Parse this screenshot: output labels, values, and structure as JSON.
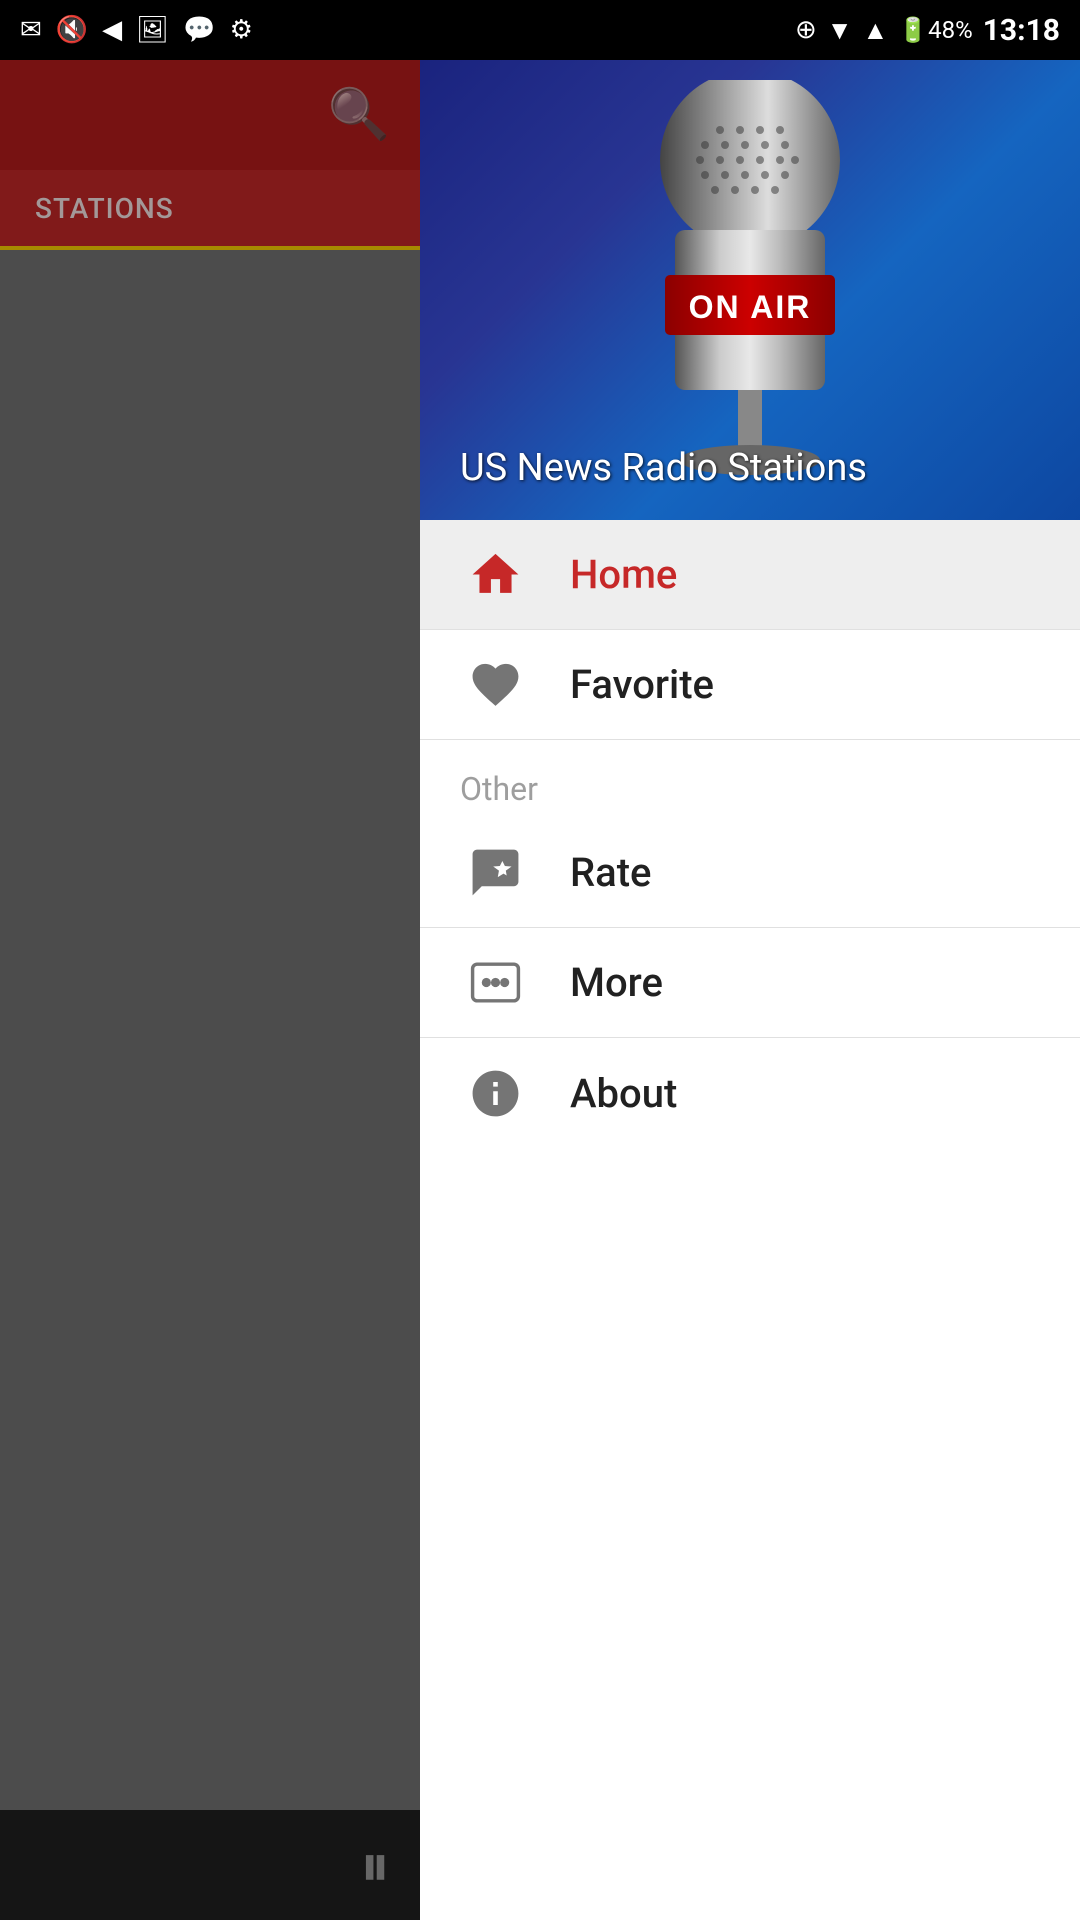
{
  "statusBar": {
    "time": "13:18",
    "battery": "48%"
  },
  "hero": {
    "title": "US News Radio Stations",
    "micLabel": "ON AIR"
  },
  "nav": {
    "homeLabel": "Home",
    "favoriteLabel": "Favorite",
    "otherSectionLabel": "Other",
    "rateLabel": "Rate",
    "moreLabel": "More",
    "aboutLabel": "About"
  },
  "appBar": {
    "tabLabel": "STATIONS"
  },
  "colors": {
    "activeRed": "#c62828",
    "tabAccent": "#ffd600",
    "dark": "#212121"
  }
}
